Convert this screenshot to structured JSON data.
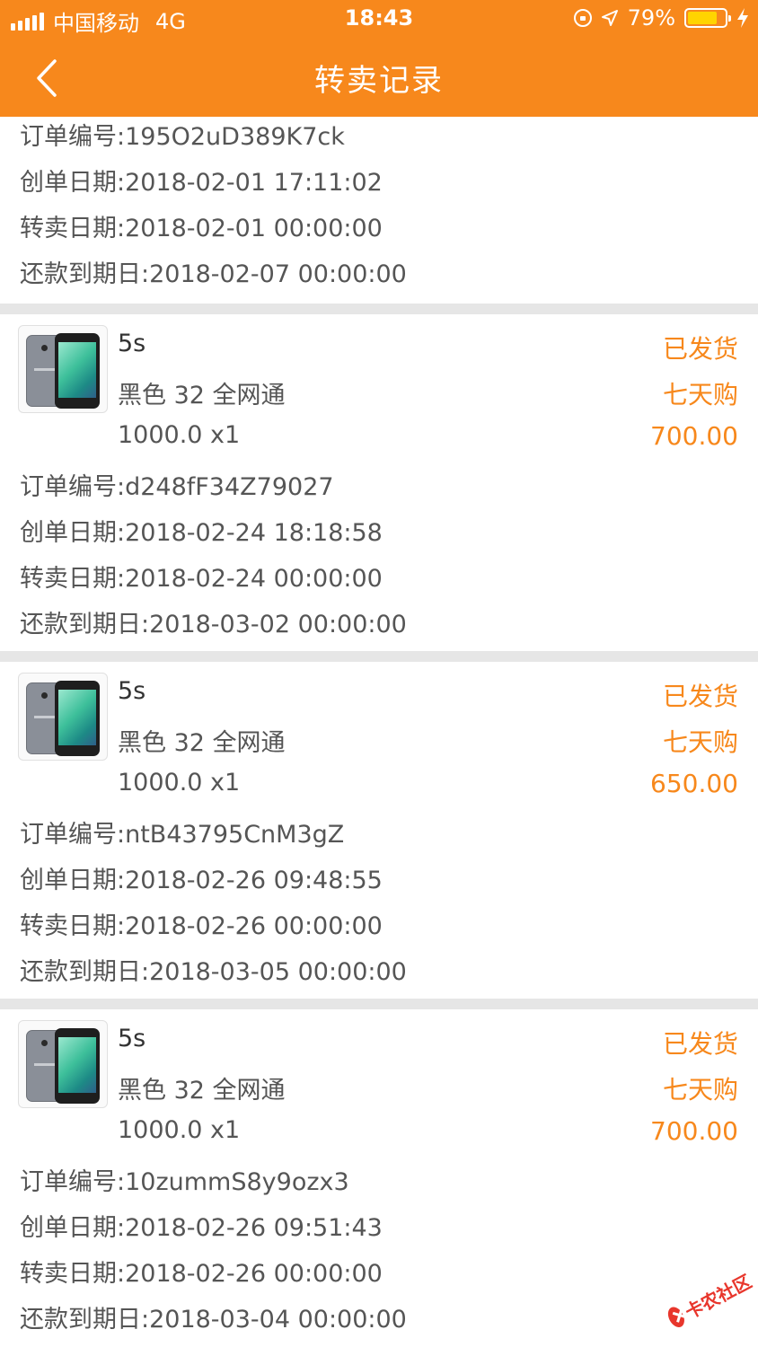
{
  "status_bar": {
    "carrier": "中国移动",
    "network": "4G",
    "time": "18:43",
    "battery": "79%",
    "battery_level": 0.79,
    "signal_icon": "signal-icon",
    "lock_icon": "orientation-lock-icon",
    "location_icon": "location-arrow-icon",
    "charging_icon": "charging-bolt-icon"
  },
  "nav": {
    "title": "转卖记录",
    "back_icon": "back-chevron-icon"
  },
  "colors": {
    "accent": "#f7881c",
    "text": "#555555",
    "separator": "#e6e6e6"
  },
  "partial_record": {
    "order_no": "订单编号:195O2uD389K7ck",
    "created": "创单日期:2018-02-01 17:11:02",
    "resold": "转卖日期:2018-02-01 00:00:00",
    "due": "还款到期日:2018-02-07 00:00:00"
  },
  "records": [
    {
      "name": "5s",
      "spec": "黑色 32 全网通",
      "price_qty": "1000.0 x1",
      "status": "已发货",
      "plan": "七天购",
      "amount": "700.00",
      "order_no": "订单编号:d248fF34Z79027",
      "created": "创单日期:2018-02-24 18:18:58",
      "resold": "转卖日期:2018-02-24 00:00:00",
      "due": "还款到期日:2018-03-02 00:00:00"
    },
    {
      "name": "5s",
      "spec": "黑色 32 全网通",
      "price_qty": "1000.0 x1",
      "status": "已发货",
      "plan": "七天购",
      "amount": "650.00",
      "order_no": "订单编号:ntB43795CnM3gZ",
      "created": "创单日期:2018-02-26 09:48:55",
      "resold": "转卖日期:2018-02-26 00:00:00",
      "due": "还款到期日:2018-03-05 00:00:00"
    },
    {
      "name": "5s",
      "spec": "黑色 32 全网通",
      "price_qty": "1000.0 x1",
      "status": "已发货",
      "plan": "七天购",
      "amount": "700.00",
      "order_no": "订单编号:10zummS8y9ozx3",
      "created": "创单日期:2018-02-26 09:51:43",
      "resold": "转卖日期:2018-02-26 00:00:00",
      "due": "还款到期日:2018-03-04 00:00:00"
    }
  ],
  "watermark": {
    "text": "卡农社区",
    "icon": "watermark-logo-icon"
  }
}
